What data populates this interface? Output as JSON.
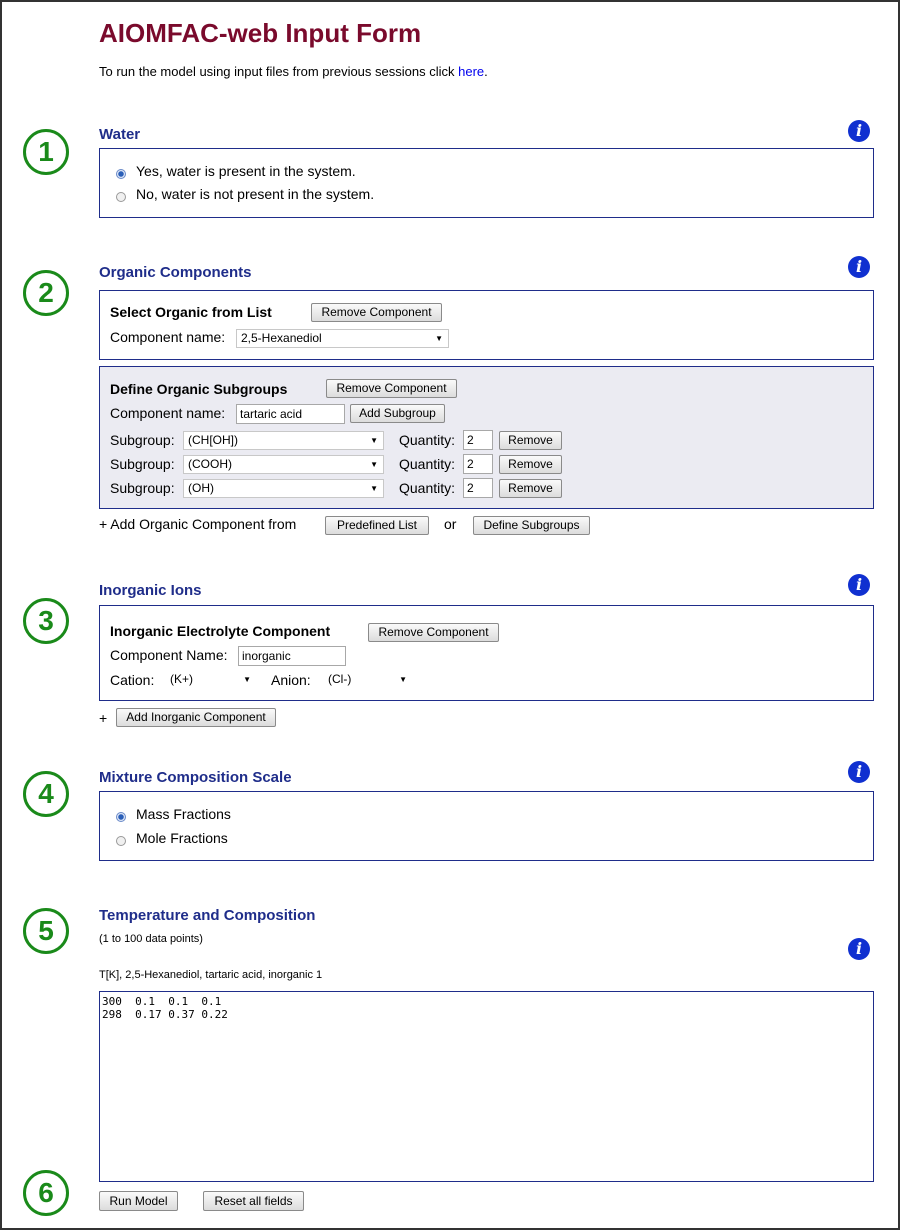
{
  "header": {
    "title": "AIOMFAC-web Input Form",
    "intro_text": "To run the model using input files from previous sessions click ",
    "intro_link": "here",
    "intro_end": "."
  },
  "step_numbers": [
    "1",
    "2",
    "3",
    "4",
    "5",
    "6"
  ],
  "info_icon_glyph": "i",
  "water": {
    "title": "Water",
    "options": [
      {
        "label": "Yes, water is present in the system.",
        "checked": true
      },
      {
        "label": "No, water is not present in the system.",
        "checked": false
      }
    ]
  },
  "organic": {
    "title": "Organic Components",
    "select_box": {
      "heading": "Select Organic from List",
      "remove_label": "Remove Component",
      "name_label": "Component name:",
      "selected": "2,5-Hexanediol"
    },
    "define_box": {
      "heading": "Define Organic Subgroups",
      "remove_label": "Remove Component",
      "name_label": "Component name:",
      "name_value": "tartaric  acid",
      "add_subgroup_label": "Add Subgroup",
      "subgroups": [
        {
          "label": "Subgroup:",
          "value": "(CH[OH])",
          "qty_label": "Quantity:",
          "qty": "2",
          "remove_label": "Remove"
        },
        {
          "label": "Subgroup:",
          "value": "(COOH)",
          "qty_label": "Quantity:",
          "qty": "2",
          "remove_label": "Remove"
        },
        {
          "label": "Subgroup:",
          "value": "(OH)",
          "qty_label": "Quantity:",
          "qty": "2",
          "remove_label": "Remove"
        }
      ]
    },
    "add_text": "+ Add Organic Component from",
    "predefined_label": "Predefined  List",
    "or_text": "or",
    "define_label": "Define  Subgroups"
  },
  "inorganic": {
    "title": "Inorganic Ions",
    "heading": "Inorganic Electrolyte Component",
    "remove_label": "Remove  Component",
    "name_label": "Component Name:",
    "name_value": "inorganic",
    "cation_label": "Cation:",
    "cation_value": "(K+)",
    "anion_label": "Anion:",
    "anion_value": "(Cl-)",
    "add_plus": "+",
    "add_label": "Add Inorganic  Component"
  },
  "mixture": {
    "title": "Mixture Composition Scale",
    "options": [
      {
        "label": "Mass Fractions",
        "checked": true
      },
      {
        "label": "Mole Fractions",
        "checked": false
      }
    ]
  },
  "temperature": {
    "title": "Temperature and Composition",
    "subtitle": "(1 to 100 data points)",
    "columns_text": "T[K], 2,5-Hexanediol, tartaric acid, inorganic 1",
    "textarea_value": "300  0.1  0.1  0.1\n298  0.17 0.37 0.22"
  },
  "actions": {
    "run_label": "Run Model",
    "reset_label": "Reset all fields"
  }
}
